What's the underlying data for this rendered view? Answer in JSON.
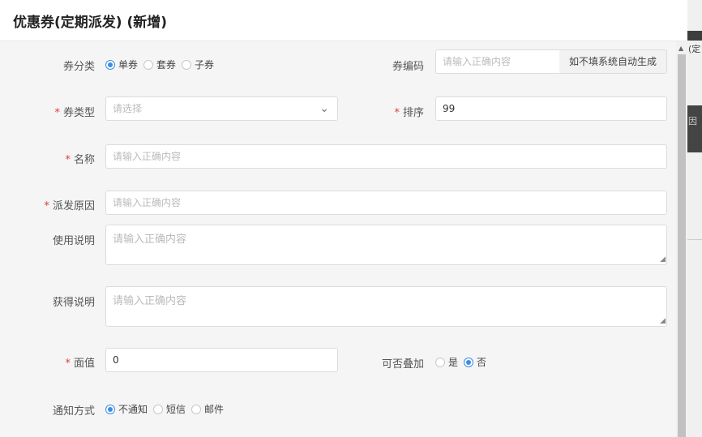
{
  "dialog": {
    "title": "优惠券(定期派发) (新增)"
  },
  "edge": {
    "text1": "(定",
    "text2": "因"
  },
  "form": {
    "coupon_category": {
      "label": "券分类",
      "options": [
        "单券",
        "套券",
        "子券"
      ],
      "selected": "单券"
    },
    "coupon_code": {
      "label": "券编码",
      "placeholder": "请输入正确内容",
      "addon": "如不填系统自动生成"
    },
    "coupon_type": {
      "label": "券类型",
      "placeholder": "请选择",
      "required": true
    },
    "sort": {
      "label": "排序",
      "value": "99",
      "required": true
    },
    "name": {
      "label": "名称",
      "placeholder": "请输入正确内容",
      "required": true
    },
    "dispatch_reason": {
      "label": "派发原因",
      "placeholder": "请输入正确内容",
      "required": true
    },
    "usage_desc": {
      "label": "使用说明",
      "placeholder": "请输入正确内容"
    },
    "obtain_desc": {
      "label": "获得说明",
      "placeholder": "请输入正确内容"
    },
    "face_value": {
      "label": "面值",
      "value": "0",
      "required": true
    },
    "stackable": {
      "label": "可否叠加",
      "options": [
        "是",
        "否"
      ],
      "selected": "否"
    },
    "notify_method": {
      "label": "通知方式",
      "options": [
        "不通知",
        "短信",
        "邮件"
      ],
      "selected": "不通知"
    }
  },
  "required_mark": "*",
  "colors": {
    "accent": "#3a8ee6",
    "required": "#e23c3c"
  }
}
